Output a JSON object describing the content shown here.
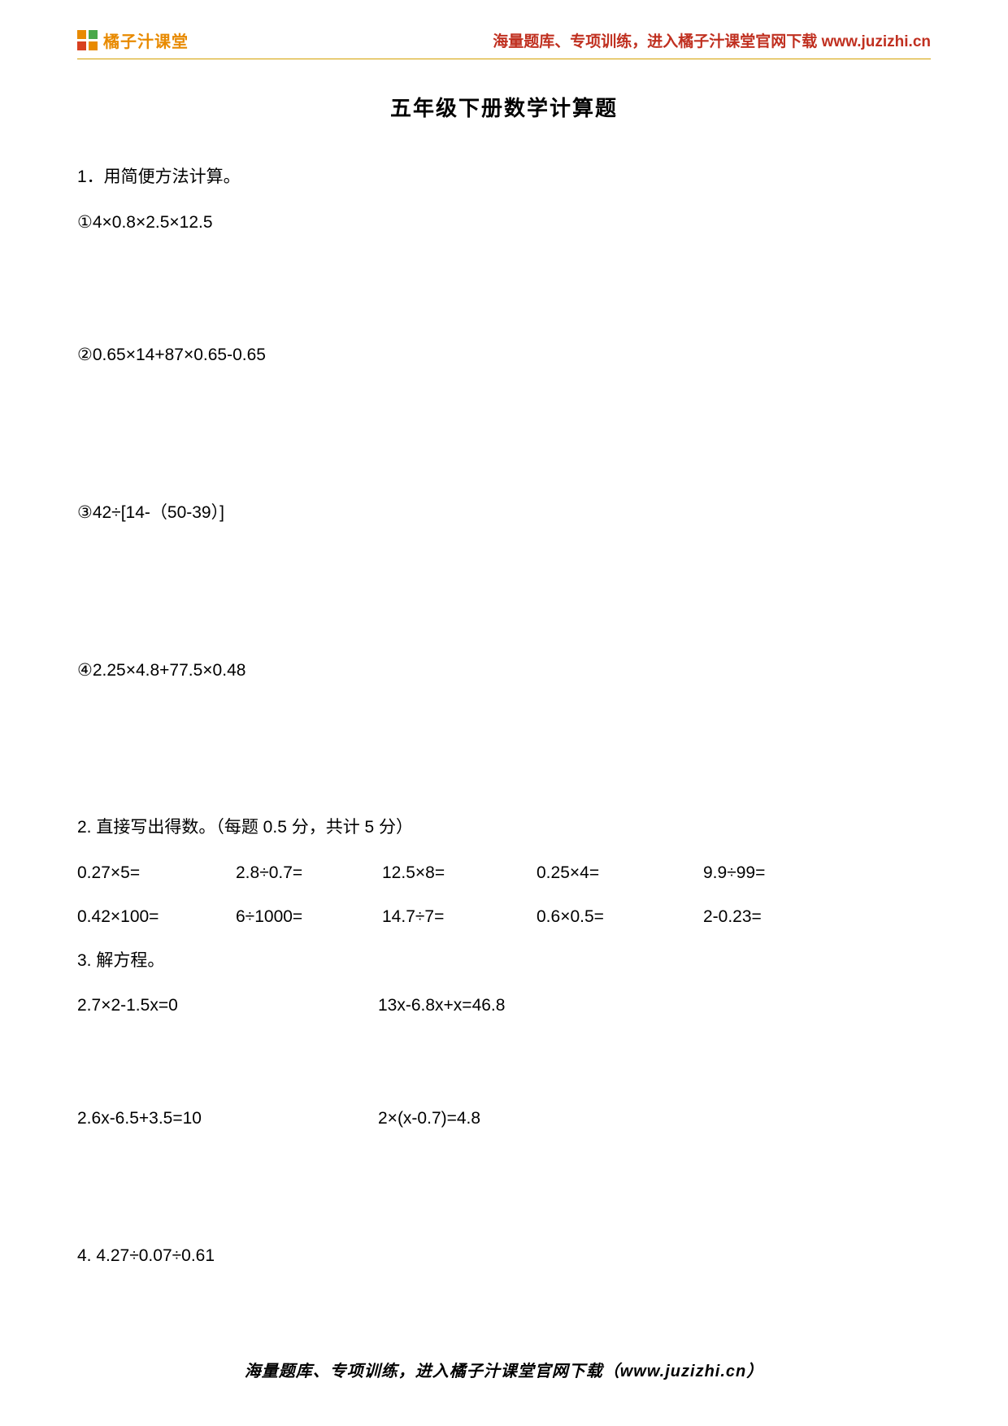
{
  "header": {
    "logo_text": "橘子汁课堂",
    "right_text_prefix": "海量题库、专项训练，进入橘子汁课堂官网下载 ",
    "right_url": "www.juzizhi.cn"
  },
  "title": "五年级下册数学计算题",
  "q1": {
    "instruction": "1．用简便方法计算。",
    "items": [
      "①4×0.8×2.5×12.5",
      "②0.65×14+87×0.65-0.65",
      "③42÷[14-（50-39）]",
      "④2.25×4.8+77.5×0.48"
    ]
  },
  "q2": {
    "instruction": "2. 直接写出得数。（每题 0.5 分，共计 5 分）",
    "row1": [
      "0.27×5=",
      "2.8÷0.7=",
      "12.5×8=",
      "0.25×4=",
      "9.9÷99="
    ],
    "row2": [
      "0.42×100=",
      "6÷1000=",
      "14.7÷7=",
      "0.6×0.5=",
      "2-0.23="
    ]
  },
  "q3": {
    "instruction": "3. 解方程。",
    "row1": [
      "2.7×2-1.5x=0",
      "13x-6.8x+x=46.8"
    ],
    "row2": [
      "2.6x-6.5+3.5=10",
      "2×(x-0.7)=4.8"
    ]
  },
  "q4": {
    "instruction": "4. 4.27÷0.07÷0.61"
  },
  "footer": "海量题库、专项训练，进入橘子汁课堂官网下载（www.juzizhi.cn）"
}
